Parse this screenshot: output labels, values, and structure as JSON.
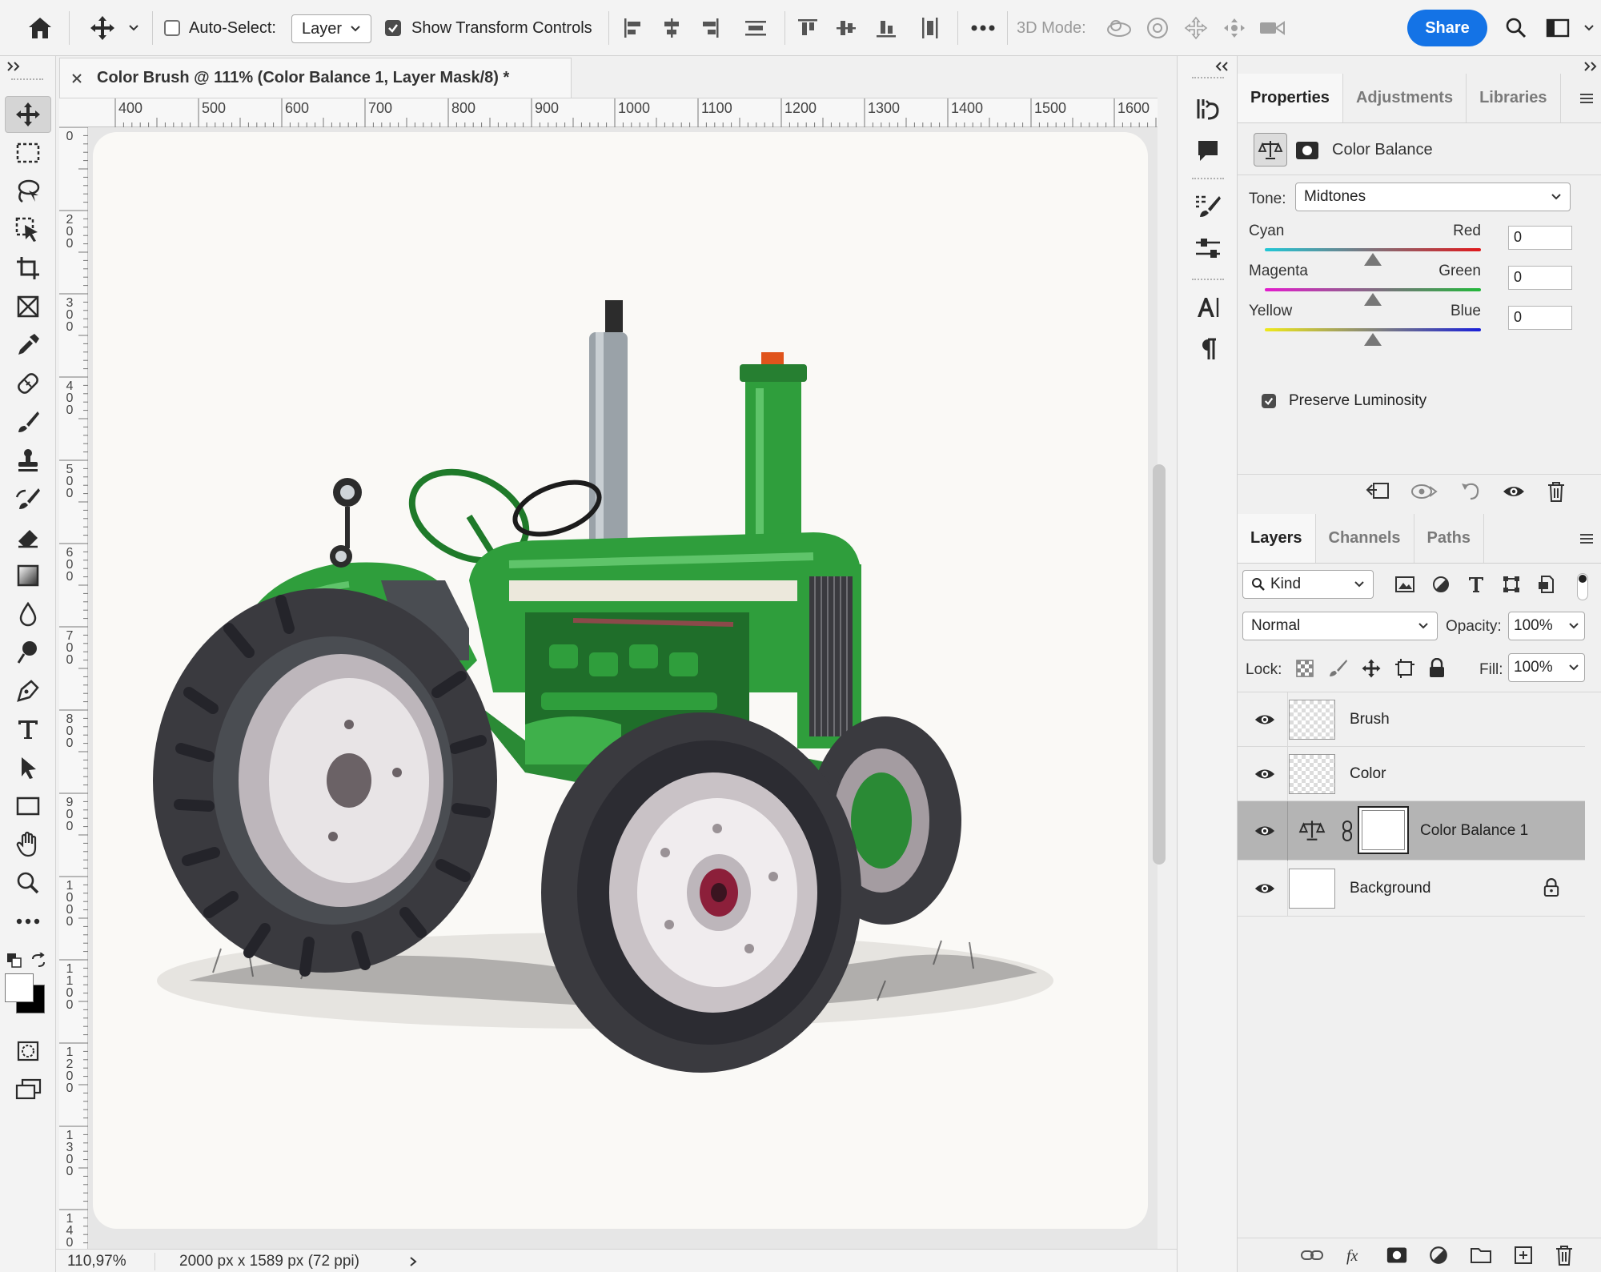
{
  "options_bar": {
    "auto_select_label": "Auto-Select:",
    "auto_select_checked": false,
    "auto_select_target": "Layer",
    "show_transform_label": "Show Transform Controls",
    "show_transform_checked": true,
    "mode_3d_label": "3D Mode:",
    "share_label": "Share"
  },
  "document": {
    "tab_title": "Color Brush @ 111% (Color Balance 1, Layer Mask/8) *",
    "ruler_h": [
      "400",
      "500",
      "600",
      "700",
      "800",
      "900",
      "1000",
      "1100",
      "1200",
      "1300",
      "1400",
      "1500",
      "1600"
    ],
    "ruler_v": [
      "0",
      "200",
      "300",
      "400",
      "500",
      "600",
      "700",
      "800",
      "900",
      "1000",
      "1100",
      "1200",
      "1300",
      "1400"
    ]
  },
  "status": {
    "zoom": "110,97%",
    "doc_size": "2000 px x 1589 px (72 ppi)"
  },
  "properties": {
    "tabs": [
      "Properties",
      "Adjustments",
      "Libraries"
    ],
    "active_tab": "Properties",
    "adjustment_name": "Color Balance",
    "tone_label": "Tone:",
    "tone_value": "Midtones",
    "sliders": [
      {
        "left": "Cyan",
        "right": "Red",
        "value": "0",
        "position": 0.5,
        "gradient": [
          "#21c7d6",
          "#e0191c"
        ]
      },
      {
        "left": "Magenta",
        "right": "Green",
        "value": "0",
        "position": 0.5,
        "gradient": [
          "#e31ccd",
          "#22b83a"
        ]
      },
      {
        "left": "Yellow",
        "right": "Blue",
        "value": "0",
        "position": 0.5,
        "gradient": [
          "#efe91a",
          "#1a20d9"
        ]
      }
    ],
    "preserve_luminosity_label": "Preserve Luminosity",
    "preserve_luminosity_checked": true
  },
  "layers_panel": {
    "tabs": [
      "Layers",
      "Channels",
      "Paths"
    ],
    "active_tab": "Layers",
    "filter_kind": "Kind",
    "blend_mode": "Normal",
    "opacity_label": "Opacity:",
    "opacity_value": "100%",
    "lock_label": "Lock:",
    "fill_label": "Fill:",
    "fill_value": "100%",
    "layers": [
      {
        "name": "Brush",
        "visible": true,
        "selected": false,
        "thumb": "transparent"
      },
      {
        "name": "Color",
        "visible": true,
        "selected": false,
        "thumb": "transparent"
      },
      {
        "name": "Color Balance 1",
        "visible": true,
        "selected": true,
        "thumb": "mask"
      },
      {
        "name": "Background",
        "visible": true,
        "selected": false,
        "thumb": "white",
        "locked": true
      }
    ]
  },
  "colors": {
    "accent": "#1473e6",
    "tractor_green": "#2f9e3c",
    "tire": "#3a3a3f"
  }
}
